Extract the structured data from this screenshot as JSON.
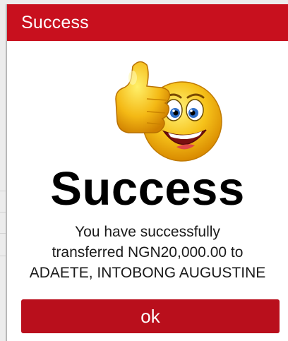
{
  "dialog": {
    "title": "Success",
    "heading": "Success",
    "message_line1": "You have successfully",
    "message_line2": "transferred NGN20,000.00 to",
    "message_line3": "ADAETE, INTOBONG AUGUSTINE",
    "ok_label": "ok",
    "icon": "thumbs-up-smiley-emoji"
  },
  "colors": {
    "header_red": "#c8101e",
    "button_red": "#b90f1c",
    "text_dark": "#000000",
    "emoji_yellow": "#f6c21a"
  }
}
